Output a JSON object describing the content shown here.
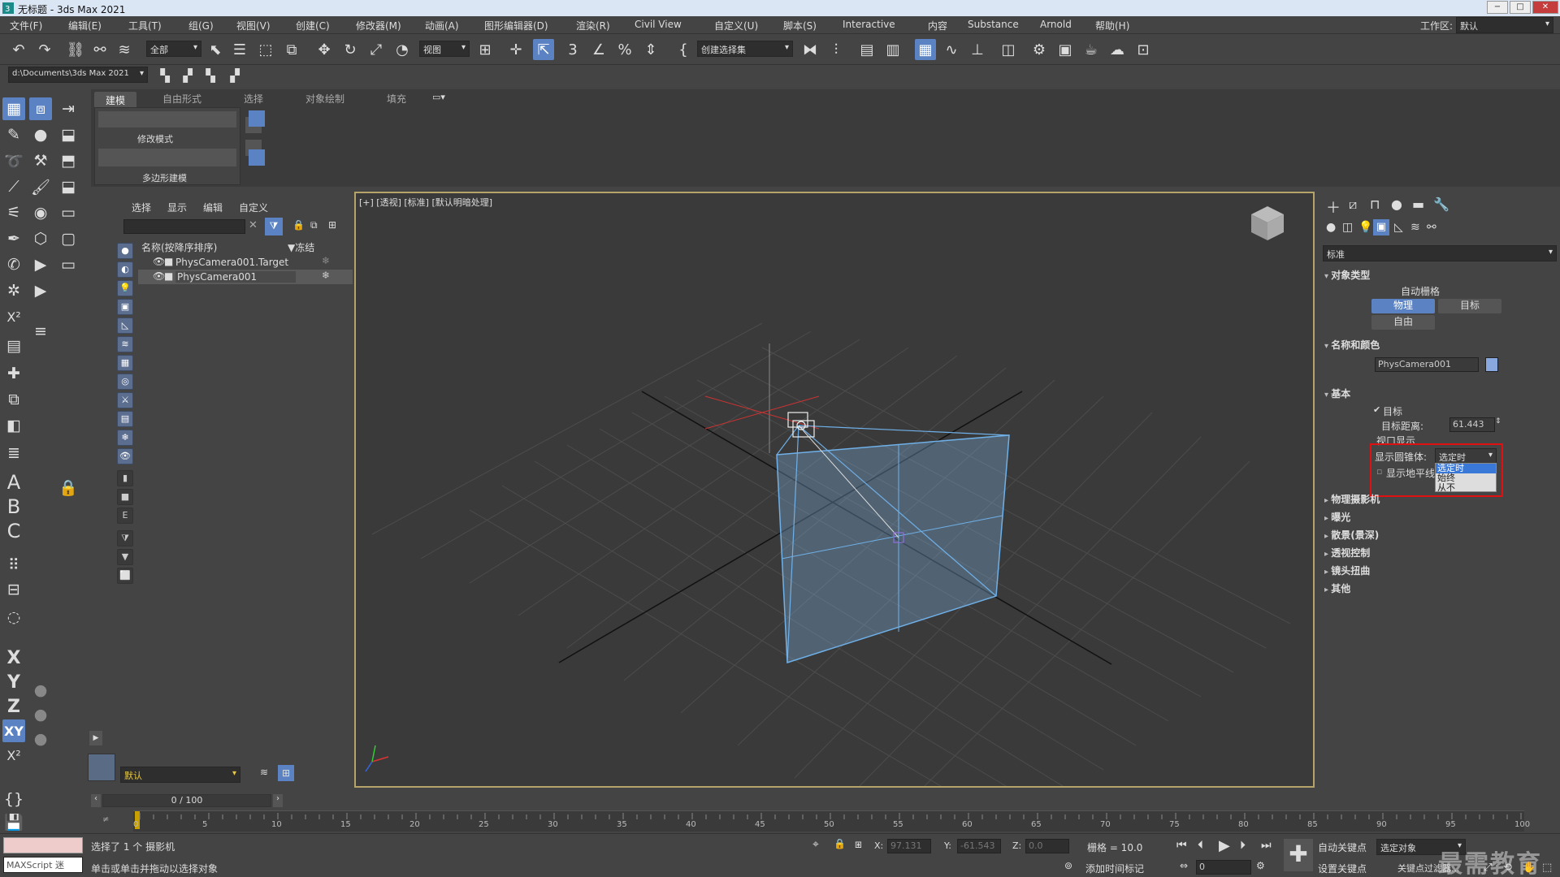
{
  "window": {
    "title": "无标题 - 3ds Max 2021",
    "controls": {
      "minimize": "−",
      "restore": "□",
      "close": "✕"
    }
  },
  "menu": [
    "文件(F)",
    "编辑(E)",
    "工具(T)",
    "组(G)",
    "视图(V)",
    "创建(C)",
    "修改器(M)",
    "动画(A)",
    "图形编辑器(D)",
    "渲染(R)",
    "Civil View",
    "自定义(U)",
    "脚本(S)",
    "Interactive",
    "内容",
    "Substance",
    "Arnold",
    "帮助(H)"
  ],
  "workspace": {
    "label": "工作区:",
    "value": "默认"
  },
  "toolbar": {
    "filter_value": "全部",
    "ref_coord_value": "视图",
    "selection_set_placeholder": "创建选择集"
  },
  "project_path": "d:\\Documents\\3ds Max 2021",
  "ribbon": {
    "tabs": [
      "建模",
      "自由形式",
      "选择",
      "对象绘制",
      "填充"
    ],
    "selected_tab": "建模",
    "group_label": "修改模式",
    "footer_label": "多边形建模"
  },
  "scene_explorer": {
    "tabs": [
      "选择",
      "显示",
      "编辑",
      "自定义"
    ],
    "col_name": "名称(按降序排序)",
    "col_frozen": "▼冻结",
    "rows": [
      {
        "name": "PhysCamera001.Target",
        "selected": false
      },
      {
        "name": "PhysCamera001",
        "selected": true
      }
    ],
    "layer_value": "默认"
  },
  "viewport": {
    "label": "[+] [透视] [标准] [默认明暗处理]"
  },
  "command_panel": {
    "category_value": "标准",
    "sections": {
      "object_type": {
        "title": "对象类型",
        "auto_grid": "自动栅格",
        "buttons": [
          "物理",
          "目标",
          "自由"
        ],
        "active_button": "物理"
      },
      "name_color": {
        "title": "名称和颜色",
        "name_value": "PhysCamera001",
        "color": "#8aa8e0"
      },
      "basic": {
        "title": "基本",
        "target_label": "目标",
        "target_checked": true,
        "target_distance_label": "目标距离:",
        "target_distance_value": "61.443",
        "viewport_display_label": "视口显示",
        "show_cone_label": "显示圆锥体:",
        "show_cone_value": "选定时",
        "show_horizon_label": "显示地平线",
        "dropdown_options": [
          "选定时",
          "始终",
          "从不"
        ],
        "highlighted_option": "选定时"
      },
      "collapsed": [
        "物理摄影机",
        "曝光",
        "散景(景深)",
        "透视控制",
        "镜头扭曲",
        "其他"
      ]
    }
  },
  "timeline": {
    "frame_display": "0 / 100",
    "ticks": [
      0,
      5,
      10,
      15,
      20,
      25,
      30,
      35,
      40,
      45,
      50,
      55,
      60,
      65,
      70,
      75,
      80,
      85,
      90,
      95,
      100
    ]
  },
  "status": {
    "maxscript_label": "MAXScript 迷",
    "message_1": "选择了 1 个 摄影机",
    "message_2": "单击或单击并拖动以选择对象",
    "x_label": "X:",
    "x_value": "97.131",
    "y_label": "Y:",
    "y_value": "-61.543",
    "z_label": "Z:",
    "z_value": "0.0",
    "grid_label": "栅格 = 10.0",
    "add_time_tag": "添加时间标记",
    "auto_key": "自动关键点",
    "set_key": "设置关键点",
    "selected_object": "选定对象",
    "key_filter": "关键点过滤器...",
    "frame_value": "0"
  },
  "watermark": "最需教育"
}
